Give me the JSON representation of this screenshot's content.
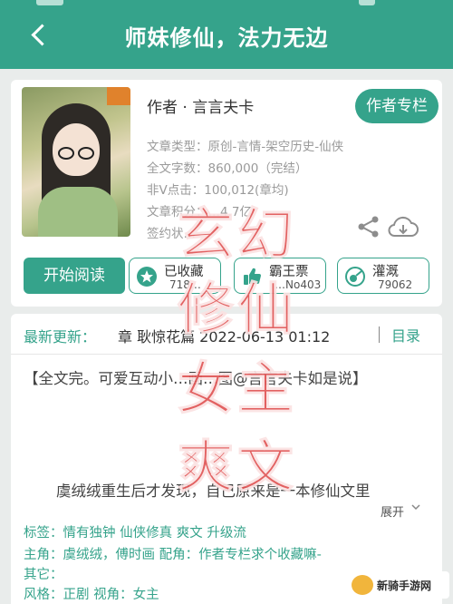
{
  "header": {
    "title": "师妹修仙，法力无边"
  },
  "book": {
    "author_line": "作者 · 言言夫卡",
    "author_column_button": "作者专栏",
    "meta": [
      "文章类型：原创-言情-架空历史-仙侠",
      "全文字数：860,000（完结）",
      "非V点击：100,012(章均)",
      "文章积分：…4.7亿",
      "签约状…"
    ],
    "start_reading": "开始阅读",
    "stats": [
      {
        "label": "已收藏",
        "count": "718…"
      },
      {
        "label": "霸王票",
        "count": "…No403"
      },
      {
        "label": "灌溉",
        "count": "79062"
      }
    ]
  },
  "update": {
    "label": "最新更新：",
    "text": "章  耿惊花篇  2022-06-13 01:12",
    "toc": "目录",
    "description": "【全文完。可爱互动小…画…图@言言夫卡如是说】",
    "intro": "虞绒绒重生后才发现，自己原来是一本修仙文里",
    "expand": "展开",
    "rows": [
      "标签：情有独钟  仙侠修真  爽文  升级流",
      "主角：虞绒绒，傅时画        配角：作者专栏求个收藏嘛-",
      "其它：",
      "风格：正剧        视角：女主"
    ]
  },
  "overlay": {
    "lines": [
      "玄幻",
      "修仙",
      "女主",
      "爽文"
    ]
  },
  "watermark": {
    "text": "新骑手游网"
  },
  "colors": {
    "accent": "#35a38b",
    "overlay": "#e05454"
  }
}
